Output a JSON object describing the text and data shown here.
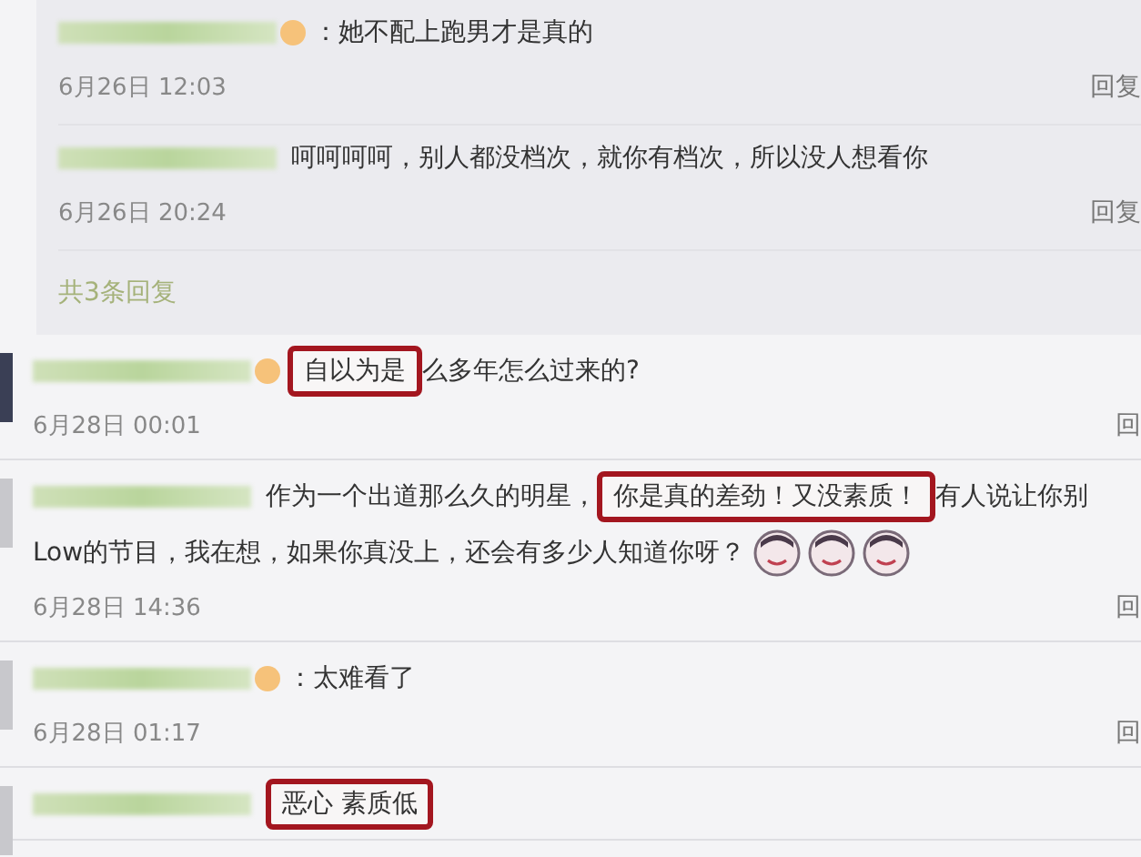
{
  "replies": {
    "items": [
      {
        "badge": true,
        "text": "：她不配上跑男才是真的",
        "time": "6月26日 12:03",
        "action": "回复"
      },
      {
        "badge": false,
        "text": "呵呵呵呵，别人都没档次，就你有档次，所以没人想看你",
        "time": "6月26日 20:24",
        "action": "回复"
      }
    ],
    "count": "共3条回复"
  },
  "comments": [
    {
      "badge": true,
      "lines": [
        [
          {
            "text": "自以为是",
            "highlighted": true
          },
          {
            "text": "么多年怎么过来的?",
            "highlighted": false
          }
        ]
      ],
      "time": "6月28日 00:01",
      "action": "回"
    },
    {
      "badge": false,
      "lines": [
        [
          {
            "text": "作为一个出道那么久的明星，",
            "highlighted": false
          },
          {
            "text": "你是真的差劲！又没素质！",
            "highlighted": true
          },
          {
            "text": "有人说让你别",
            "highlighted": false
          }
        ],
        [
          {
            "text": "Low的节目，我在想，如果你真没上，还会有多少人知道你呀？",
            "highlighted": false
          }
        ]
      ],
      "emojis": [
        {
          "kind": "face"
        },
        {
          "kind": "face"
        },
        {
          "kind": "face"
        }
      ],
      "time": "6月28日 14:36",
      "action": "回"
    },
    {
      "badge": true,
      "lines": [
        [
          {
            "text": "：太难看了",
            "highlighted": false
          }
        ]
      ],
      "time": "6月28日 01:17",
      "action": "回"
    },
    {
      "badge": false,
      "lines": [
        [
          {
            "text": "恶心 素质低",
            "highlighted": true
          }
        ]
      ]
    }
  ]
}
